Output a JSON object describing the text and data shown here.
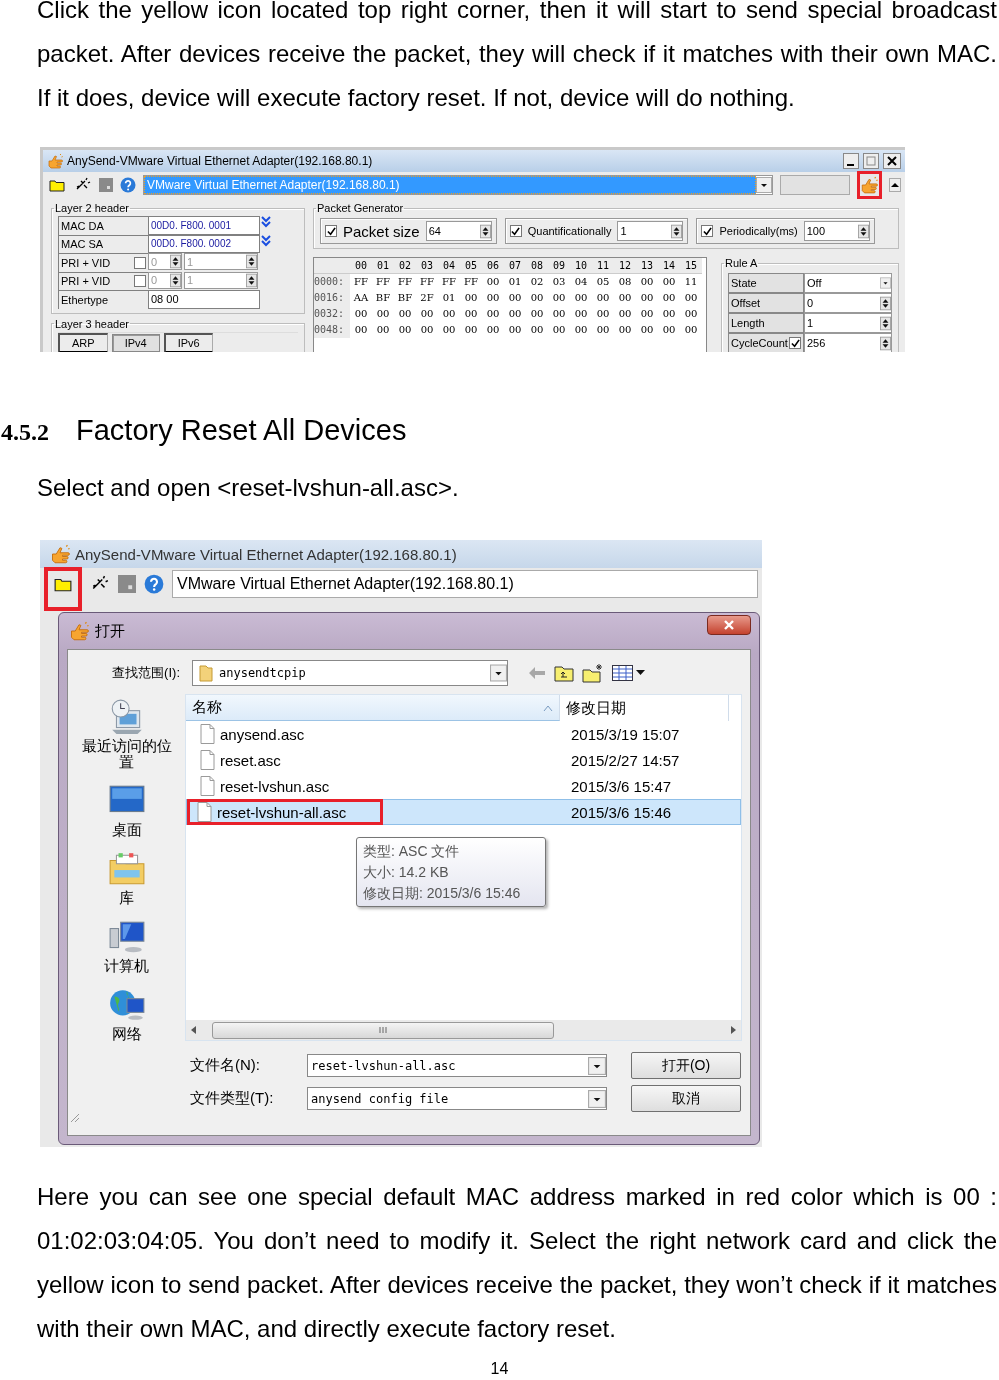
{
  "intro": "Click the yellow icon located top right corner, then it will start to send special broadcast packet. After devices receive the packet, they will check if it matches with their own MAC. If it does, device will execute factory reset. If not, device will do nothing.",
  "screenshot_1": {
    "window_title": "AnySend-VMware Virtual Ethernet Adapter(192.168.80.1)",
    "adapter": "VMware Virtual Ethernet Adapter(192.168.80.1)",
    "send_marked": true,
    "layer2": {
      "title": "Layer 2 header",
      "rows": [
        {
          "kind": "field",
          "label": "MAC DA",
          "value": "00D0. F800. 0001"
        },
        {
          "kind": "field",
          "label": "MAC SA",
          "value": "00D0. F800. 0002"
        },
        {
          "kind": "vlan",
          "label": "PRI + VID",
          "checked": false,
          "pri": "0",
          "vid": "1"
        },
        {
          "kind": "vlan",
          "label": "PRI + VID",
          "checked": false,
          "pri": "0",
          "vid": "1"
        },
        {
          "kind": "plain",
          "label": "Ethertype",
          "value": "08 00"
        }
      ]
    },
    "layer3": {
      "title": "Layer 3 header",
      "tabs": [
        {
          "label": "ARP",
          "selected": false
        },
        {
          "label": "IPv4",
          "selected": true
        },
        {
          "label": "IPv6",
          "selected": false
        }
      ]
    },
    "generator": {
      "title": "Packet Generator",
      "options": [
        {
          "label": "Packet size",
          "checked": true,
          "value": "64"
        },
        {
          "label": "Quantificationally",
          "checked": true,
          "value": "1"
        },
        {
          "label": "Periodically(ms)",
          "checked": true,
          "value": "100"
        }
      ]
    },
    "hex": {
      "columns": [
        "00",
        "01",
        "02",
        "03",
        "04",
        "05",
        "06",
        "07",
        "08",
        "09",
        "10",
        "11",
        "12",
        "13",
        "14",
        "15"
      ],
      "rows": [
        {
          "offset": "0000:",
          "bytes": [
            "FF",
            "FF",
            "FF",
            "FF",
            "FF",
            "FF",
            "00",
            "01",
            "02",
            "03",
            "04",
            "05",
            "08",
            "00",
            "00",
            "11"
          ]
        },
        {
          "offset": "0016:",
          "bytes": [
            "AA",
            "BF",
            "BF",
            "2F",
            "01",
            "00",
            "00",
            "00",
            "00",
            "00",
            "00",
            "00",
            "00",
            "00",
            "00",
            "00"
          ]
        },
        {
          "offset": "0032:",
          "bytes": [
            "00",
            "00",
            "00",
            "00",
            "00",
            "00",
            "00",
            "00",
            "00",
            "00",
            "00",
            "00",
            "00",
            "00",
            "00",
            "00"
          ]
        },
        {
          "offset": "0048:",
          "bytes": [
            "00",
            "00",
            "00",
            "00",
            "00",
            "00",
            "00",
            "00",
            "00",
            "00",
            "00",
            "00",
            "00",
            "00",
            "00",
            "00"
          ]
        }
      ]
    },
    "rule": {
      "title": "Rule A",
      "rows": [
        {
          "kind": "select",
          "label": "State",
          "value": "Off"
        },
        {
          "kind": "spin",
          "label": "Offset",
          "value": "0"
        },
        {
          "kind": "spin",
          "label": "Length",
          "value": "1"
        },
        {
          "kind": "check_spin",
          "label": "CycleCount",
          "checked": true,
          "value": "256"
        }
      ]
    }
  },
  "heading": {
    "number": "4.5.2",
    "title": "Factory Reset All Devices"
  },
  "instruction": "Select and open <reset-lvshun-all.asc>.",
  "screenshot_2": {
    "window_title": "AnySend-VMware Virtual Ethernet Adapter(192.168.80.1)",
    "adapter": "VMware Virtual Ethernet Adapter(192.168.80.1)",
    "open_marked": true,
    "dialog": {
      "title": "打开",
      "look_in_label": "查找范围(I):",
      "look_in": "anysendtcpip",
      "places": [
        {
          "kind": "recent",
          "label": "最近访问的位置"
        },
        {
          "kind": "desktop",
          "label": "桌面"
        },
        {
          "kind": "library",
          "label": "库"
        },
        {
          "kind": "computer",
          "label": "计算机"
        },
        {
          "kind": "network",
          "label": "网络"
        }
      ],
      "columns": [
        "名称",
        "修改日期"
      ],
      "files": [
        {
          "name": "anysend.asc",
          "modified": "2015/3/19 15:07",
          "selected": false,
          "marked": false
        },
        {
          "name": "reset.asc",
          "modified": "2015/2/27 14:57",
          "selected": false,
          "marked": false
        },
        {
          "name": "reset-lvshun.asc",
          "modified": "2015/3/6 15:47",
          "selected": false,
          "marked": false
        },
        {
          "name": "reset-lvshun-all.asc",
          "modified": "2015/3/6 15:46",
          "selected": true,
          "marked": true
        }
      ],
      "tooltip": [
        "类型: ASC 文件",
        "大小: 14.2 KB",
        "修改日期: 2015/3/6 15:46"
      ],
      "filename_label": "文件名(N):",
      "filename": "reset-lvshun-all.asc",
      "filetype_label": "文件类型(T):",
      "filetype": "anysend config file",
      "buttons": [
        "打开(O)",
        "取消"
      ]
    }
  },
  "outro": "Here you can see one special default MAC address marked in red color which is 00 : 01:02:03:04:05. You don’t need to modify it. Select the right network card and click the yellow icon to send packet. After devices receive the packet, they won’t check if it matches with their own MAC, and directly execute factory reset.",
  "page_number": "14"
}
